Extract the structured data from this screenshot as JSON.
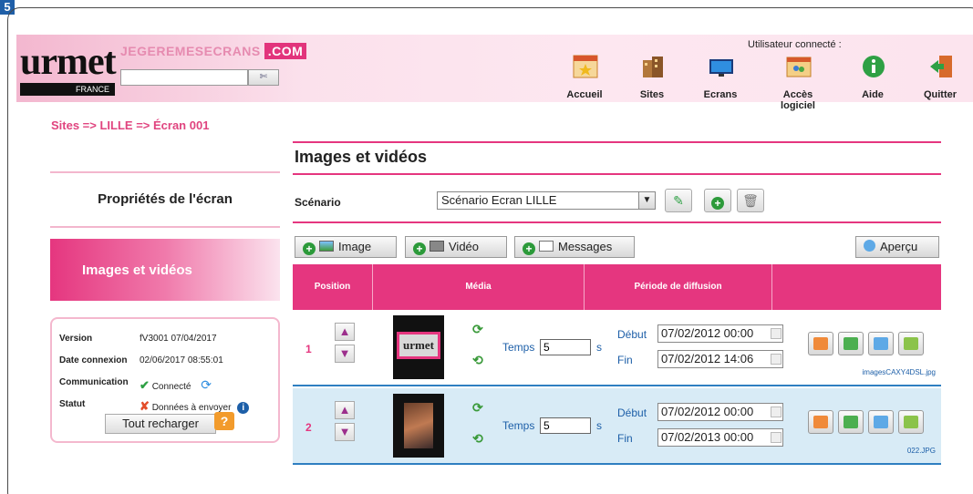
{
  "corner_tag": "5",
  "header": {
    "logo": "urmet",
    "logo_sub": "FRANCE",
    "brand": "JEGEREMESECRANS",
    "brand_com": ".COM",
    "search": {
      "value": "",
      "button": "✄"
    },
    "user_label": "Utilisateur connecté : ",
    "nav": [
      {
        "label": "Accueil",
        "icon": "home-icon"
      },
      {
        "label": "Sites",
        "icon": "buildings-icon"
      },
      {
        "label": "Ecrans",
        "icon": "screen-icon"
      },
      {
        "label": "Accès logiciel",
        "icon": "software-access-icon"
      },
      {
        "label": "Aide",
        "icon": "help-icon"
      },
      {
        "label": "Quitter",
        "icon": "exit-icon"
      }
    ]
  },
  "breadcrumb": "Sites => LILLE => Écran 001",
  "sidebar": {
    "properties": "Propriétés de l'écran",
    "active": "Images et vidéos"
  },
  "info": {
    "version_key": "Version",
    "version_val": "fV3001 07/04/2017",
    "date_key": "Date connexion",
    "date_val": "02/06/2017 08:55:01",
    "comm_key": "Communication",
    "comm_val": "Connecté",
    "status_key": "Statut",
    "status_val": "Données à envoyer",
    "reload": "Tout recharger"
  },
  "main": {
    "title": "Images et vidéos",
    "scenario_label": "Scénario",
    "scenario_value": "Scénario Ecran LILLE",
    "toolbar": {
      "image": "Image",
      "video": "Vidéo",
      "messages": "Messages",
      "preview": "Aperçu"
    },
    "columns": [
      "Position",
      "Média",
      "Période de diffusion",
      ""
    ],
    "rows": [
      {
        "position": "1",
        "temps_label": "Temps",
        "temps": "5",
        "unit": "s",
        "debut_label": "Début",
        "debut": "07/02/2012 00:00",
        "fin_label": "Fin",
        "fin": "07/02/2012 14:06",
        "filename": "imagesCAXY4DSL.jpg"
      },
      {
        "position": "2",
        "temps_label": "Temps",
        "temps": "5",
        "unit": "s",
        "debut_label": "Début",
        "debut": "07/02/2012 00:00",
        "fin_label": "Fin",
        "fin": "07/02/2013 00:00",
        "filename": "022.JPG"
      }
    ]
  }
}
